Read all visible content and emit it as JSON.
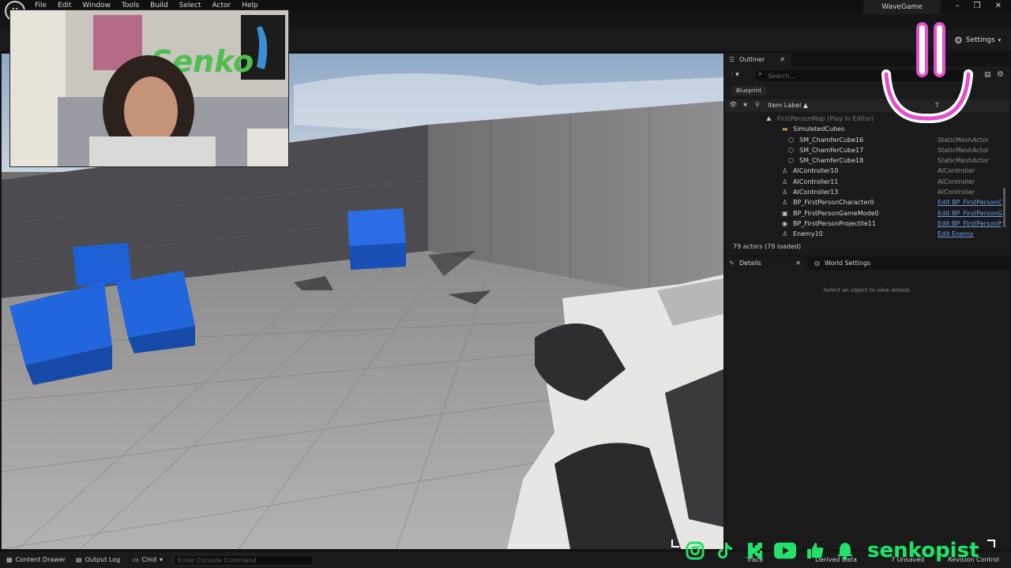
{
  "app": {
    "logo_text": "U",
    "window_title": "WaveGame",
    "menu": [
      "File",
      "Edit",
      "Window",
      "Tools",
      "Build",
      "Select",
      "Actor",
      "Help"
    ],
    "window_controls": [
      "–",
      "❐",
      "✕"
    ]
  },
  "toolbar": {
    "settings_label": "Settings"
  },
  "overlay": {
    "brand": "senkopist",
    "webcam_sign": "Senko",
    "smiley_color": "#e24fcf",
    "brand_color": "#22e06a"
  },
  "outliner": {
    "tab_label": "Outliner",
    "search_placeholder": "Search...",
    "filter_chip": "Blueprint",
    "column_label": "Item Label ▲",
    "column_type": "T",
    "rows": [
      {
        "name": "FirstPersonMap (Play In Editor)",
        "type": "",
        "indent": 66,
        "icon": "⛰",
        "kind": "dim"
      },
      {
        "name": "SimulatedCubes",
        "type": "",
        "indent": 86,
        "icon": "▬",
        "kind": "folder"
      },
      {
        "name": "SM_ChamferCube16",
        "type": "StaticMeshActor",
        "indent": 94,
        "icon": "⬡",
        "kind": ""
      },
      {
        "name": "SM_ChamferCube17",
        "type": "StaticMeshActor",
        "indent": 94,
        "icon": "⬡",
        "kind": ""
      },
      {
        "name": "SM_ChamferCube18",
        "type": "StaticMeshActor",
        "indent": 94,
        "icon": "⬡",
        "kind": ""
      },
      {
        "name": "AIController10",
        "type": "AIController",
        "indent": 86,
        "icon": "♙",
        "kind": ""
      },
      {
        "name": "AIController11",
        "type": "AIController",
        "indent": 86,
        "icon": "♙",
        "kind": ""
      },
      {
        "name": "AIController13",
        "type": "AIController",
        "indent": 86,
        "icon": "♙",
        "kind": ""
      },
      {
        "name": "BP_FirstPersonCharacter0",
        "type": "Edit BP_FirstPersonC",
        "indent": 86,
        "icon": "♙",
        "kind": "link"
      },
      {
        "name": "BP_FirstPersonGameMode0",
        "type": "Edit BP_FirstPersonG",
        "indent": 86,
        "icon": "▣",
        "kind": "link"
      },
      {
        "name": "BP_FirstPersonProjectile11",
        "type": "Edit BP_FirstPersonP",
        "indent": 86,
        "icon": "◉",
        "kind": "link"
      },
      {
        "name": "Enemy10",
        "type": "Edit Enemy",
        "indent": 86,
        "icon": "♙",
        "kind": "link"
      }
    ],
    "actor_count": "79 actors (79 loaded)"
  },
  "details": {
    "tab_label": "Details",
    "world_settings_label": "World Settings",
    "hint": "Select an object to view details."
  },
  "bottombar": {
    "content_drawer": "Content Drawer",
    "output_log": "Output Log",
    "cmd": "Cmd",
    "console_placeholder": "Enter Console Command",
    "trace": "Trace",
    "derived_data": "Derived Data",
    "unsaved": "7 Unsaved",
    "revision_control": "Revision Control"
  }
}
